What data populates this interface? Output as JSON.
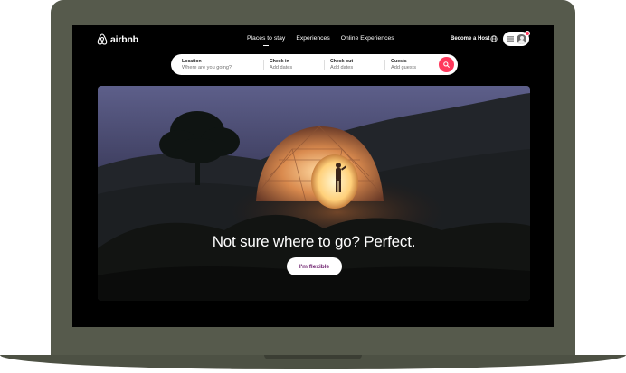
{
  "brand": {
    "name": "airbnb",
    "icon": "airbnb-logo-icon",
    "accent": "#ff385c"
  },
  "nav": {
    "menu": [
      {
        "label": "Places to stay",
        "active": true
      },
      {
        "label": "Experiences",
        "active": false
      },
      {
        "label": "Online Experiences",
        "active": false
      }
    ],
    "become_host": "Become a Host",
    "globe_icon": "globe-icon",
    "menu_icon": "hamburger-icon",
    "avatar_icon": "user-avatar-icon"
  },
  "search": {
    "location": {
      "label": "Location",
      "placeholder": "Where are you going?"
    },
    "check_in": {
      "label": "Check in",
      "placeholder": "Add dates"
    },
    "check_out": {
      "label": "Check out",
      "placeholder": "Add dates"
    },
    "guests": {
      "label": "Guests",
      "placeholder": "Add guests"
    },
    "button_icon": "search-icon"
  },
  "hero": {
    "headline": "Not sure where to go? Perfect.",
    "button_label": "I'm flexible"
  }
}
